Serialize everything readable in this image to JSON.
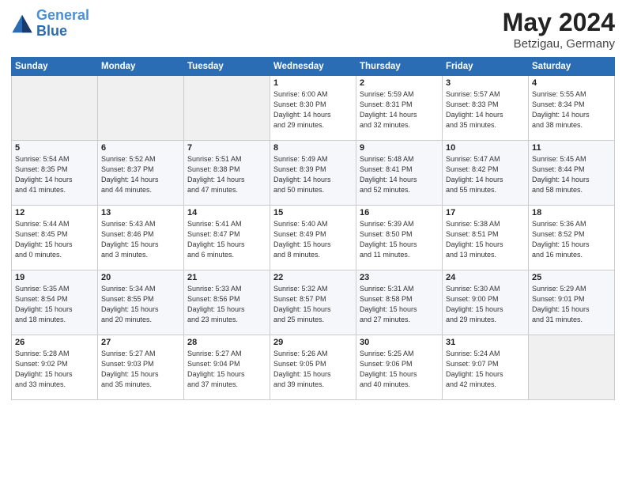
{
  "header": {
    "logo_line1": "General",
    "logo_line2": "Blue",
    "month": "May 2024",
    "location": "Betzigau, Germany"
  },
  "weekdays": [
    "Sunday",
    "Monday",
    "Tuesday",
    "Wednesday",
    "Thursday",
    "Friday",
    "Saturday"
  ],
  "weeks": [
    [
      {
        "day": "",
        "info": ""
      },
      {
        "day": "",
        "info": ""
      },
      {
        "day": "",
        "info": ""
      },
      {
        "day": "1",
        "info": "Sunrise: 6:00 AM\nSunset: 8:30 PM\nDaylight: 14 hours\nand 29 minutes."
      },
      {
        "day": "2",
        "info": "Sunrise: 5:59 AM\nSunset: 8:31 PM\nDaylight: 14 hours\nand 32 minutes."
      },
      {
        "day": "3",
        "info": "Sunrise: 5:57 AM\nSunset: 8:33 PM\nDaylight: 14 hours\nand 35 minutes."
      },
      {
        "day": "4",
        "info": "Sunrise: 5:55 AM\nSunset: 8:34 PM\nDaylight: 14 hours\nand 38 minutes."
      }
    ],
    [
      {
        "day": "5",
        "info": "Sunrise: 5:54 AM\nSunset: 8:35 PM\nDaylight: 14 hours\nand 41 minutes."
      },
      {
        "day": "6",
        "info": "Sunrise: 5:52 AM\nSunset: 8:37 PM\nDaylight: 14 hours\nand 44 minutes."
      },
      {
        "day": "7",
        "info": "Sunrise: 5:51 AM\nSunset: 8:38 PM\nDaylight: 14 hours\nand 47 minutes."
      },
      {
        "day": "8",
        "info": "Sunrise: 5:49 AM\nSunset: 8:39 PM\nDaylight: 14 hours\nand 50 minutes."
      },
      {
        "day": "9",
        "info": "Sunrise: 5:48 AM\nSunset: 8:41 PM\nDaylight: 14 hours\nand 52 minutes."
      },
      {
        "day": "10",
        "info": "Sunrise: 5:47 AM\nSunset: 8:42 PM\nDaylight: 14 hours\nand 55 minutes."
      },
      {
        "day": "11",
        "info": "Sunrise: 5:45 AM\nSunset: 8:44 PM\nDaylight: 14 hours\nand 58 minutes."
      }
    ],
    [
      {
        "day": "12",
        "info": "Sunrise: 5:44 AM\nSunset: 8:45 PM\nDaylight: 15 hours\nand 0 minutes."
      },
      {
        "day": "13",
        "info": "Sunrise: 5:43 AM\nSunset: 8:46 PM\nDaylight: 15 hours\nand 3 minutes."
      },
      {
        "day": "14",
        "info": "Sunrise: 5:41 AM\nSunset: 8:47 PM\nDaylight: 15 hours\nand 6 minutes."
      },
      {
        "day": "15",
        "info": "Sunrise: 5:40 AM\nSunset: 8:49 PM\nDaylight: 15 hours\nand 8 minutes."
      },
      {
        "day": "16",
        "info": "Sunrise: 5:39 AM\nSunset: 8:50 PM\nDaylight: 15 hours\nand 11 minutes."
      },
      {
        "day": "17",
        "info": "Sunrise: 5:38 AM\nSunset: 8:51 PM\nDaylight: 15 hours\nand 13 minutes."
      },
      {
        "day": "18",
        "info": "Sunrise: 5:36 AM\nSunset: 8:52 PM\nDaylight: 15 hours\nand 16 minutes."
      }
    ],
    [
      {
        "day": "19",
        "info": "Sunrise: 5:35 AM\nSunset: 8:54 PM\nDaylight: 15 hours\nand 18 minutes."
      },
      {
        "day": "20",
        "info": "Sunrise: 5:34 AM\nSunset: 8:55 PM\nDaylight: 15 hours\nand 20 minutes."
      },
      {
        "day": "21",
        "info": "Sunrise: 5:33 AM\nSunset: 8:56 PM\nDaylight: 15 hours\nand 23 minutes."
      },
      {
        "day": "22",
        "info": "Sunrise: 5:32 AM\nSunset: 8:57 PM\nDaylight: 15 hours\nand 25 minutes."
      },
      {
        "day": "23",
        "info": "Sunrise: 5:31 AM\nSunset: 8:58 PM\nDaylight: 15 hours\nand 27 minutes."
      },
      {
        "day": "24",
        "info": "Sunrise: 5:30 AM\nSunset: 9:00 PM\nDaylight: 15 hours\nand 29 minutes."
      },
      {
        "day": "25",
        "info": "Sunrise: 5:29 AM\nSunset: 9:01 PM\nDaylight: 15 hours\nand 31 minutes."
      }
    ],
    [
      {
        "day": "26",
        "info": "Sunrise: 5:28 AM\nSunset: 9:02 PM\nDaylight: 15 hours\nand 33 minutes."
      },
      {
        "day": "27",
        "info": "Sunrise: 5:27 AM\nSunset: 9:03 PM\nDaylight: 15 hours\nand 35 minutes."
      },
      {
        "day": "28",
        "info": "Sunrise: 5:27 AM\nSunset: 9:04 PM\nDaylight: 15 hours\nand 37 minutes."
      },
      {
        "day": "29",
        "info": "Sunrise: 5:26 AM\nSunset: 9:05 PM\nDaylight: 15 hours\nand 39 minutes."
      },
      {
        "day": "30",
        "info": "Sunrise: 5:25 AM\nSunset: 9:06 PM\nDaylight: 15 hours\nand 40 minutes."
      },
      {
        "day": "31",
        "info": "Sunrise: 5:24 AM\nSunset: 9:07 PM\nDaylight: 15 hours\nand 42 minutes."
      },
      {
        "day": "",
        "info": ""
      }
    ]
  ]
}
